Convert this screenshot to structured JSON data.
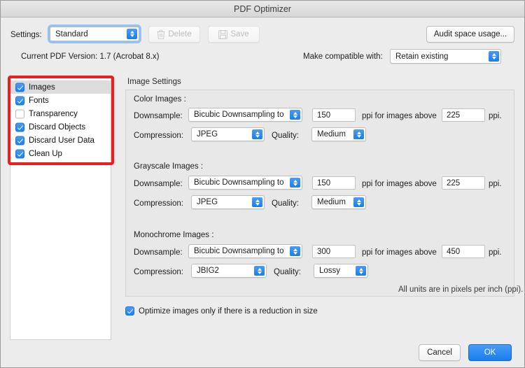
{
  "window": {
    "title": "PDF Optimizer"
  },
  "toolbar": {
    "settings_label": "Settings:",
    "settings_value": "Standard",
    "delete_label": "Delete",
    "delete_icon": "trash-icon",
    "save_label": "Save",
    "save_icon": "floppy-disk-icon",
    "audit_label": "Audit space usage..."
  },
  "version_row": {
    "current_version": "Current PDF Version: 1.7 (Acrobat 8.x)",
    "compatible_label": "Make compatible with:",
    "compatible_value": "Retain existing"
  },
  "panel_list": {
    "items": [
      {
        "label": "Images",
        "checked": true,
        "selected": true
      },
      {
        "label": "Fonts",
        "checked": true,
        "selected": false
      },
      {
        "label": "Transparency",
        "checked": false,
        "selected": false
      },
      {
        "label": "Discard Objects",
        "checked": true,
        "selected": false
      },
      {
        "label": "Discard User Data",
        "checked": true,
        "selected": false
      },
      {
        "label": "Clean Up",
        "checked": true,
        "selected": false
      }
    ]
  },
  "image_settings": {
    "group_label": "Image Settings",
    "downsample_label": "Downsample:",
    "compression_label": "Compression:",
    "quality_label": "Quality:",
    "ppi_above_label": "ppi for images above",
    "ppi_suffix": "ppi.",
    "units_note": "All units are in pixels per inch (ppi).",
    "sections": [
      {
        "title": "Color Images :",
        "downsample_method": "Bicubic Downsampling to",
        "downsample_ppi": "150",
        "above_ppi": "225",
        "compression": "JPEG",
        "quality": "Medium"
      },
      {
        "title": "Grayscale Images :",
        "downsample_method": "Bicubic Downsampling to",
        "downsample_ppi": "150",
        "above_ppi": "225",
        "compression": "JPEG",
        "quality": "Medium"
      },
      {
        "title": "Monochrome Images :",
        "downsample_method": "Bicubic Downsampling to",
        "downsample_ppi": "300",
        "above_ppi": "450",
        "compression": "JBIG2",
        "quality": "Lossy"
      }
    ]
  },
  "footer": {
    "optimize_label": "Optimize images only if there is a reduction in size",
    "optimize_checked": true,
    "cancel_label": "Cancel",
    "ok_label": "OK"
  },
  "colors": {
    "accent_blue": "#1a7ded",
    "annotation_red": "#ee1c1c",
    "window_bg": "#ececec",
    "group_bg": "#e8e8e8"
  }
}
